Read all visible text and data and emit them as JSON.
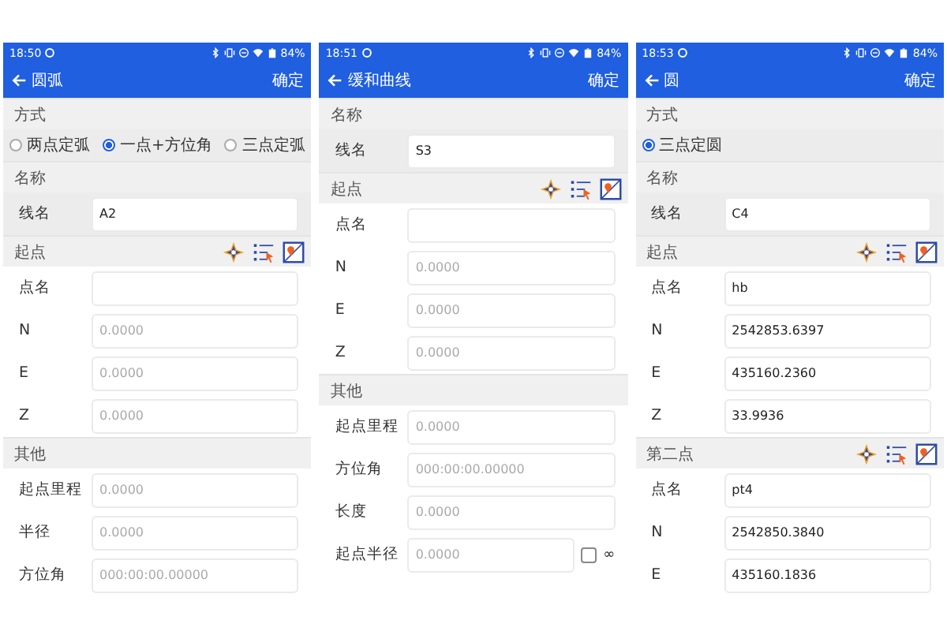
{
  "screens": [
    {
      "time": "18:50",
      "battery": "84%",
      "title": "圆弧",
      "confirm": "确定",
      "sections": [
        {
          "title": "方式",
          "options": [
            {
              "label": "两点定弧",
              "selected": false
            },
            {
              "label": "一点+方位角",
              "selected": true
            },
            {
              "label": "三点定弧",
              "selected": false
            }
          ]
        },
        {
          "title": "名称",
          "shaded": true,
          "fields": [
            {
              "kind": "text",
              "label": "线名",
              "value": "A2"
            }
          ]
        },
        {
          "title": "起点",
          "tools": true,
          "fields": [
            {
              "kind": "text",
              "label": "点名"
            },
            {
              "kind": "text",
              "label": "N",
              "placeholder": "0.0000"
            },
            {
              "kind": "text",
              "label": "E",
              "placeholder": "0.0000"
            },
            {
              "kind": "text",
              "label": "Z",
              "placeholder": "0.0000"
            }
          ]
        },
        {
          "title": "其他",
          "fields": [
            {
              "kind": "text",
              "label": "起点里程",
              "placeholder": "0.0000"
            },
            {
              "kind": "text",
              "label": "半径",
              "placeholder": "0.0000"
            },
            {
              "kind": "text",
              "label": "方位角",
              "placeholder": "000:00:00.00000"
            }
          ]
        }
      ]
    },
    {
      "time": "18:51",
      "battery": "84%",
      "title": "缓和曲线",
      "confirm": "确定",
      "sections": [
        {
          "title": "名称",
          "shaded": true,
          "fields": [
            {
              "kind": "text",
              "label": "线名",
              "value": "S3"
            }
          ]
        },
        {
          "title": "起点",
          "tools": true,
          "fields": [
            {
              "kind": "text",
              "label": "点名"
            },
            {
              "kind": "text",
              "label": "N",
              "placeholder": "0.0000"
            },
            {
              "kind": "text",
              "label": "E",
              "placeholder": "0.0000"
            },
            {
              "kind": "text",
              "label": "Z",
              "placeholder": "0.0000"
            }
          ]
        },
        {
          "title": "其他",
          "fields": [
            {
              "kind": "text",
              "label": "起点里程",
              "placeholder": "0.0000"
            },
            {
              "kind": "text",
              "label": "方位角",
              "placeholder": "000:00:00.00000"
            },
            {
              "kind": "text",
              "label": "长度",
              "placeholder": "0.0000"
            },
            {
              "kind": "checkbox",
              "label": "起点半径",
              "placeholder": "0.0000",
              "checked": false,
              "check_label": "∞"
            }
          ]
        }
      ]
    },
    {
      "time": "18:53",
      "battery": "84%",
      "title": "圆",
      "confirm": "确定",
      "sections": [
        {
          "title": "方式",
          "options": [
            {
              "label": "三点定圆",
              "selected": true
            }
          ]
        },
        {
          "title": "名称",
          "shaded": true,
          "fields": [
            {
              "kind": "text",
              "label": "线名",
              "value": "C4"
            }
          ]
        },
        {
          "title": "起点",
          "tools": true,
          "fields": [
            {
              "kind": "text",
              "label": "点名",
              "value": "hb"
            },
            {
              "kind": "text",
              "label": "N",
              "value": "2542853.6397"
            },
            {
              "kind": "text",
              "label": "E",
              "value": "435160.2360"
            },
            {
              "kind": "text",
              "label": "Z",
              "value": "33.9936"
            }
          ]
        },
        {
          "title": "第二点",
          "tools": true,
          "fields": [
            {
              "kind": "text",
              "label": "点名",
              "value": "pt4"
            },
            {
              "kind": "text",
              "label": "N",
              "value": "2542850.3840"
            },
            {
              "kind": "text",
              "label": "E",
              "value": "435160.1836"
            }
          ]
        }
      ]
    }
  ]
}
